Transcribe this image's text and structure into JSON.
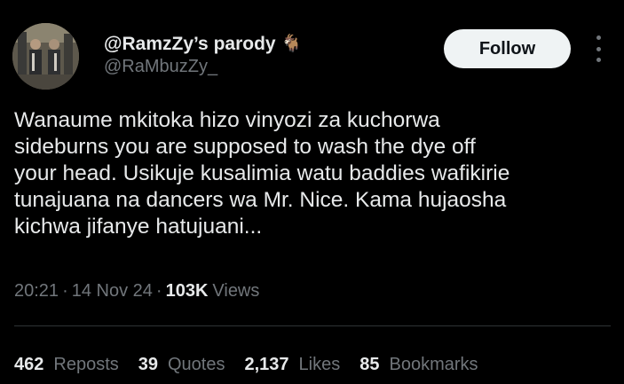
{
  "author": {
    "display_name": "@RamzZy’s parody",
    "badge_emoji": "🐐",
    "handle": "@RaMbuzZy_"
  },
  "actions": {
    "follow_label": "Follow"
  },
  "tweet": {
    "lines": [
      "Wanaume mkitoka hizo vinyozi za kuchorwa",
      "sideburns you are supposed to wash the dye off",
      "your head. Usikuje kusalimia watu baddies wafikirie",
      "tunajuana na dancers wa Mr. Nice. Kama hujaosha",
      "kichwa jifanye hatujuani..."
    ]
  },
  "meta": {
    "time": "20:21",
    "separator": "·",
    "date": "14 Nov 24",
    "views_count": "103K",
    "views_label": "Views"
  },
  "stats": [
    {
      "count": "462",
      "label": "Reposts"
    },
    {
      "count": "39",
      "label": "Quotes"
    },
    {
      "count": "2,137",
      "label": "Likes"
    },
    {
      "count": "85",
      "label": "Bookmarks"
    }
  ],
  "colors": {
    "background": "#000000",
    "primary_text": "#e7e9ea",
    "secondary_text": "#71767b",
    "follow_bg": "#eff3f4",
    "divider": "#2f3336"
  }
}
